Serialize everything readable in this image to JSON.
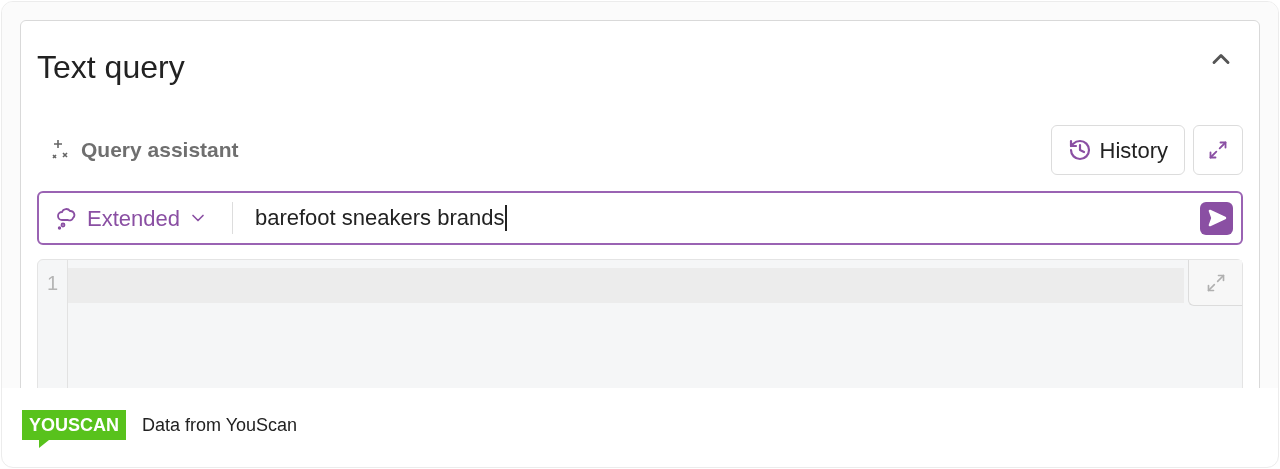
{
  "panel": {
    "title": "Text query",
    "expanded": true
  },
  "toolbar": {
    "assistant_label": "Query assistant",
    "history_label": "History"
  },
  "query_input": {
    "mode": "Extended",
    "value": "barefoot sneakers brands"
  },
  "editor": {
    "line_numbers": [
      "1"
    ]
  },
  "footer": {
    "logo": "YOUSCAN",
    "text": "Data from YouScan"
  }
}
